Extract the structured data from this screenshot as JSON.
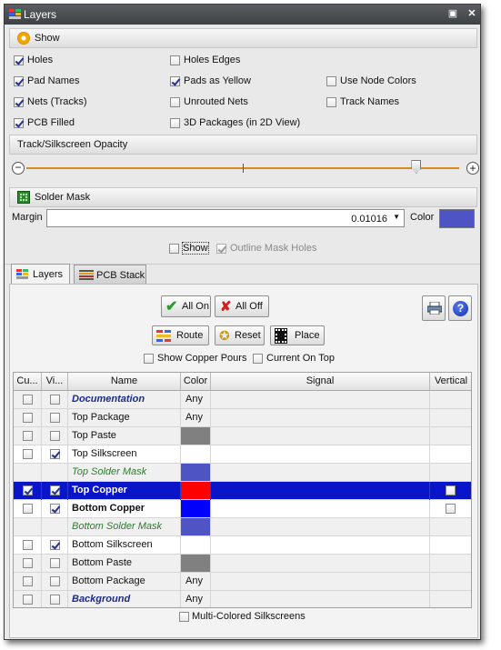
{
  "window": {
    "title": "Layers",
    "pin_glyph": "▣",
    "close_glyph": "✕"
  },
  "show_section": {
    "label": "Show"
  },
  "show_options": [
    {
      "key": "holes",
      "label": "Holes",
      "checked": true
    },
    {
      "key": "holes_edges",
      "label": "Holes Edges",
      "checked": false
    },
    {
      "key": "pad_names",
      "label": "Pad Names",
      "checked": true
    },
    {
      "key": "pads_yellow",
      "label": "Pads as Yellow",
      "checked": true
    },
    {
      "key": "use_node_colors",
      "label": "Use Node Colors",
      "checked": false
    },
    {
      "key": "nets_tracks",
      "label": "Nets (Tracks)",
      "checked": true
    },
    {
      "key": "unrouted_nets",
      "label": "Unrouted Nets",
      "checked": false
    },
    {
      "key": "track_names",
      "label": "Track Names",
      "checked": false
    },
    {
      "key": "pcb_filled",
      "label": "PCB Filled",
      "checked": true
    },
    {
      "key": "packages_3d",
      "label": "3D Packages (in 2D View)",
      "checked": false
    }
  ],
  "opacity_section": {
    "label": "Track/Silkscreen Opacity",
    "value": 0.9
  },
  "solder_mask": {
    "label": "Solder Mask",
    "margin_label": "Margin",
    "margin_value": "0.01016",
    "color_label": "Color",
    "color": "#4f54c4",
    "show_label": "Show",
    "show_checked": false,
    "outline_label": "Outline Mask Holes",
    "outline_checked": true
  },
  "tabs": [
    {
      "label": "Layers",
      "active": true
    },
    {
      "label": "PCB Stack",
      "active": false
    }
  ],
  "buttons": {
    "all_on": "All On",
    "all_off": "All Off",
    "route": "Route",
    "reset": "Reset",
    "place": "Place"
  },
  "options": {
    "show_copper_pours": "Show Copper Pours",
    "current_on_top": "Current On Top",
    "multi_colored": "Multi-Colored Silkscreens"
  },
  "columns": [
    "Cu...",
    "Vi...",
    "Name",
    "Color",
    "Signal",
    "Vertical"
  ],
  "layers": [
    {
      "name": "Documentation",
      "style": "doc",
      "current": false,
      "visible": false,
      "color_text": "Any",
      "color": null,
      "bg": "gray",
      "vertical": null
    },
    {
      "name": "Top Package",
      "style": "normal",
      "current": false,
      "visible": false,
      "color_text": "Any",
      "color": null,
      "bg": "gray",
      "vertical": null
    },
    {
      "name": "Top Paste",
      "style": "normal",
      "current": false,
      "visible": false,
      "color_text": "",
      "color": "#808080",
      "bg": "gray",
      "vertical": null
    },
    {
      "name": "Top Silkscreen",
      "style": "normal",
      "current": false,
      "visible": true,
      "color_text": "",
      "color": "#ffffff",
      "bg": "white",
      "vertical": null
    },
    {
      "name": "Top Solder Mask",
      "style": "mask",
      "current": null,
      "visible": null,
      "color_text": "",
      "color": "#4f54c4",
      "bg": "gray",
      "vertical": null
    },
    {
      "name": "Top Copper",
      "style": "copper",
      "current": true,
      "visible": true,
      "color_text": "",
      "color": "#ff0000",
      "bg": "sel",
      "vertical": false
    },
    {
      "name": "Bottom Copper",
      "style": "copper",
      "current": false,
      "visible": true,
      "color_text": "",
      "color": "#0000ff",
      "bg": "white",
      "vertical": false
    },
    {
      "name": "Bottom Solder Mask",
      "style": "mask",
      "current": null,
      "visible": null,
      "color_text": "",
      "color": "#4f54c4",
      "bg": "gray",
      "vertical": null
    },
    {
      "name": "Bottom Silkscreen",
      "style": "normal",
      "current": false,
      "visible": true,
      "color_text": "",
      "color": "#ffffff",
      "bg": "white",
      "vertical": null
    },
    {
      "name": "Bottom Paste",
      "style": "normal",
      "current": false,
      "visible": false,
      "color_text": "",
      "color": "#808080",
      "bg": "gray",
      "vertical": null
    },
    {
      "name": "Bottom Package",
      "style": "normal",
      "current": false,
      "visible": false,
      "color_text": "Any",
      "color": null,
      "bg": "gray",
      "vertical": null
    },
    {
      "name": "Background",
      "style": "doc",
      "current": false,
      "visible": false,
      "color_text": "Any",
      "color": null,
      "bg": "gray",
      "vertical": null
    }
  ]
}
